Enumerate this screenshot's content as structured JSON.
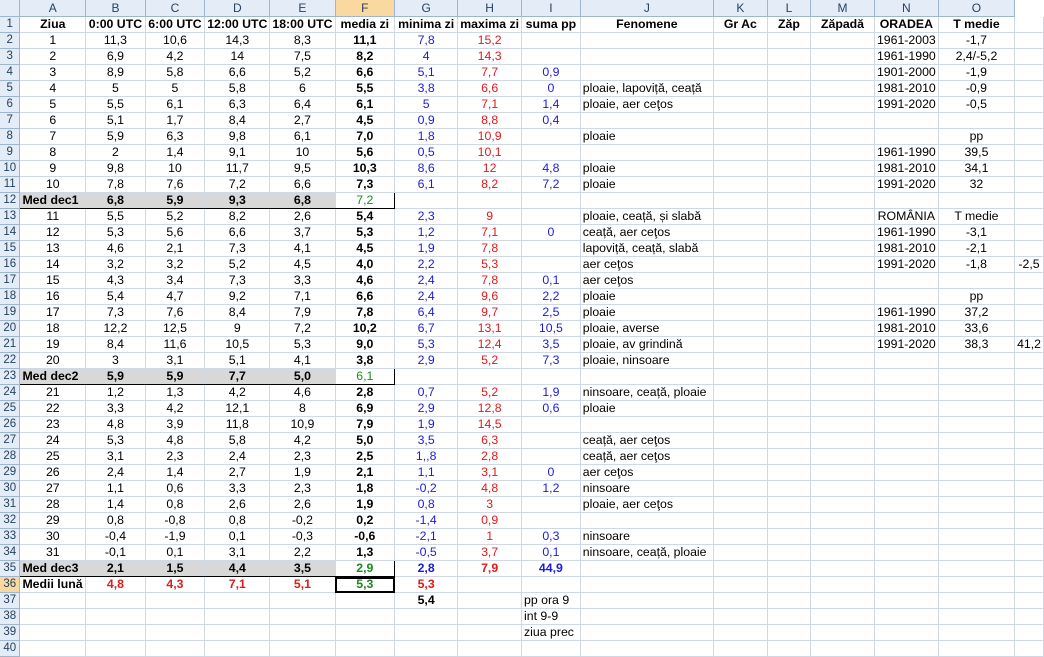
{
  "columns": [
    "A",
    "B",
    "C",
    "D",
    "E",
    "F",
    "G",
    "H",
    "I",
    "J",
    "K",
    "L",
    "M",
    "N",
    "O"
  ],
  "active_col": "F",
  "active_row": 36,
  "rows": [
    {
      "r": 1,
      "type": "header",
      "cells": [
        "Ziua",
        "0:00 UTC",
        "6:00 UTC",
        "12:00 UTC",
        "18:00 UTC",
        "media zi",
        "minima zi",
        "maxima zi",
        "suma pp",
        "Fenomene",
        "Gr Ac",
        "Zăp",
        "Zăpadă",
        "ORADEA",
        "T medie",
        ""
      ]
    },
    {
      "r": 2,
      "type": "day",
      "cells": [
        "1",
        "11,3",
        "10,6",
        "14,3",
        "8,3",
        "11,1",
        "7,8",
        "15,2",
        "",
        "",
        "",
        "",
        "",
        "1961-2003",
        "-1,7",
        ""
      ]
    },
    {
      "r": 3,
      "type": "day",
      "cells": [
        "2",
        "6,9",
        "4,2",
        "14",
        "7,5",
        "8,2",
        "4",
        "14,3",
        "",
        "",
        "",
        "",
        "",
        "1961-1990",
        "2,4/-5,2",
        ""
      ]
    },
    {
      "r": 4,
      "type": "day",
      "cells": [
        "3",
        "8,9",
        "5,8",
        "6,6",
        "5,2",
        "6,6",
        "5,1",
        "7,7",
        "0,9",
        "",
        "",
        "",
        "",
        "1901-2000",
        "-1,9",
        ""
      ]
    },
    {
      "r": 5,
      "type": "day",
      "cells": [
        "4",
        "5",
        "5",
        "5,8",
        "6",
        "5,5",
        "3,8",
        "6,6",
        "0",
        "ploaie, lapoviță, ceață",
        "",
        "",
        "",
        "1981-2010",
        "-0,9",
        ""
      ]
    },
    {
      "r": 6,
      "type": "day",
      "cells": [
        "5",
        "5,5",
        "6,1",
        "6,3",
        "6,4",
        "6,1",
        "5",
        "7,1",
        "1,4",
        "ploaie, aer ceţos",
        "",
        "",
        "",
        "1991-2020",
        "-0,5",
        ""
      ]
    },
    {
      "r": 7,
      "type": "day",
      "cells": [
        "6",
        "5,1",
        "1,7",
        "8,4",
        "2,7",
        "4,5",
        "0,9",
        "8,8",
        "0,4",
        "",
        "",
        "",
        "",
        "",
        "",
        ""
      ]
    },
    {
      "r": 8,
      "type": "day",
      "cells": [
        "7",
        "5,9",
        "6,3",
        "9,8",
        "6,1",
        "7,0",
        "1,8",
        "10,9",
        "",
        "ploaie",
        "",
        "",
        "",
        "",
        "pp",
        ""
      ]
    },
    {
      "r": 9,
      "type": "day",
      "cells": [
        "8",
        "2",
        "1,4",
        "9,1",
        "10",
        "5,6",
        "0,5",
        "10,1",
        "",
        "",
        "",
        "",
        "",
        "1961-1990",
        "39,5",
        ""
      ]
    },
    {
      "r": 10,
      "type": "day",
      "cells": [
        "9",
        "9,8",
        "10",
        "11,7",
        "9,5",
        "10,3",
        "8,6",
        "12",
        "4,8",
        "ploaie",
        "",
        "",
        "",
        "1981-2010",
        "34,1",
        ""
      ]
    },
    {
      "r": 11,
      "type": "day",
      "cells": [
        "10",
        "7,8",
        "7,6",
        "7,2",
        "6,6",
        "7,3",
        "6,1",
        "8,2",
        "7,2",
        "ploaie",
        "",
        "",
        "",
        "1991-2020",
        "32",
        ""
      ]
    },
    {
      "r": 12,
      "type": "dec",
      "cells": [
        "Med dec1",
        "6,8",
        "5,9",
        "9,3",
        "6,8",
        "7,2",
        "",
        "",
        "",
        "",
        "",
        "",
        "",
        "",
        "",
        ""
      ]
    },
    {
      "r": 13,
      "type": "day",
      "cells": [
        "11",
        "5,5",
        "5,2",
        "8,2",
        "2,6",
        "5,4",
        "2,3",
        "9",
        "",
        "ploaie, ceață, și slabă",
        "",
        "",
        "",
        "ROMÂNIA",
        "T medie",
        ""
      ]
    },
    {
      "r": 14,
      "type": "day",
      "cells": [
        "12",
        "5,3",
        "5,6",
        "6,6",
        "3,7",
        "5,3",
        "1,2",
        "7,1",
        "0",
        "ceață, aer ceţos",
        "",
        "",
        "",
        "1961-1990",
        "-3,1",
        ""
      ]
    },
    {
      "r": 15,
      "type": "day",
      "cells": [
        "13",
        "4,6",
        "2,1",
        "7,3",
        "4,1",
        "4,5",
        "1,9",
        "7,8",
        "",
        "lapoviță, ceață, slabă",
        "",
        "",
        "",
        "1981-2010",
        "-2,1",
        ""
      ]
    },
    {
      "r": 16,
      "type": "day",
      "cells": [
        "14",
        "3,2",
        "3,2",
        "5,2",
        "4,5",
        "4,0",
        "2,2",
        "5,3",
        "",
        "aer ceţos",
        "",
        "",
        "",
        "1991-2020",
        "-1,8",
        "-2,5"
      ]
    },
    {
      "r": 17,
      "type": "day",
      "cells": [
        "15",
        "4,3",
        "3,4",
        "7,3",
        "3,3",
        "4,6",
        "2,4",
        "7,8",
        "0,1",
        "aer ceţos",
        "",
        "",
        "",
        "",
        "",
        ""
      ]
    },
    {
      "r": 18,
      "type": "day",
      "cells": [
        "16",
        "5,4",
        "4,7",
        "9,2",
        "7,1",
        "6,6",
        "2,4",
        "9,6",
        "2,2",
        "ploaie",
        "",
        "",
        "",
        "",
        "pp",
        ""
      ]
    },
    {
      "r": 19,
      "type": "day",
      "cells": [
        "17",
        "7,3",
        "7,6",
        "8,4",
        "7,9",
        "7,8",
        "6,4",
        "9,7",
        "2,5",
        "ploaie",
        "",
        "",
        "",
        "1961-1990",
        "37,2",
        ""
      ]
    },
    {
      "r": 20,
      "type": "day",
      "cells": [
        "18",
        "12,2",
        "12,5",
        "9",
        "7,2",
        "10,2",
        "6,7",
        "13,1",
        "10,5",
        "ploaie, averse",
        "",
        "",
        "",
        "1981-2010",
        "33,6",
        ""
      ]
    },
    {
      "r": 21,
      "type": "day",
      "cells": [
        "19",
        "8,4",
        "11,6",
        "10,5",
        "5,3",
        "9,0",
        "5,3",
        "12,4",
        "3,5",
        "ploaie, av grindină",
        "",
        "",
        "",
        "1991-2020",
        "38,3",
        "41,2"
      ]
    },
    {
      "r": 22,
      "type": "day",
      "cells": [
        "20",
        "3",
        "3,1",
        "5,1",
        "4,1",
        "3,8",
        "2,9",
        "5,2",
        "7,3",
        "ploaie, ninsoare",
        "",
        "",
        "",
        "",
        "",
        ""
      ]
    },
    {
      "r": 23,
      "type": "dec",
      "cells": [
        "Med dec2",
        "5,9",
        "5,9",
        "7,7",
        "5,0",
        "6,1",
        "",
        "",
        "",
        "",
        "",
        "",
        "",
        "",
        "",
        ""
      ]
    },
    {
      "r": 24,
      "type": "day",
      "cells": [
        "21",
        "1,2",
        "1,3",
        "4,2",
        "4,6",
        "2,8",
        "0,7",
        "5,2",
        "1,9",
        "ninsoare, ceață, ploaie",
        "",
        "",
        "",
        "",
        "",
        ""
      ]
    },
    {
      "r": 25,
      "type": "day",
      "cells": [
        "22",
        "3,3",
        "4,2",
        "12,1",
        "8",
        "6,9",
        "2,9",
        "12,8",
        "0,6",
        "ploaie",
        "",
        "",
        "",
        "",
        "",
        ""
      ]
    },
    {
      "r": 26,
      "type": "day",
      "cells": [
        "23",
        "4,8",
        "3,9",
        "11,8",
        "10,9",
        "7,9",
        "1,9",
        "14,5",
        "",
        "",
        "",
        "",
        "",
        "",
        "",
        ""
      ]
    },
    {
      "r": 27,
      "type": "day",
      "cells": [
        "24",
        "5,3",
        "4,8",
        "5,8",
        "4,2",
        "5,0",
        "3,5",
        "6,3",
        "",
        "ceață, aer ceţos",
        "",
        "",
        "",
        "",
        "",
        ""
      ]
    },
    {
      "r": 28,
      "type": "day",
      "cells": [
        "25",
        "3,1",
        "2,3",
        "2,4",
        "2,3",
        "2,5",
        "1,,8",
        "2,8",
        "",
        "ceață, aer ceţos",
        "",
        "",
        "",
        "",
        "",
        ""
      ]
    },
    {
      "r": 29,
      "type": "day",
      "cells": [
        "26",
        "2,4",
        "1,4",
        "2,7",
        "1,9",
        "2,1",
        "1,1",
        "3,1",
        "0",
        "aer ceţos",
        "",
        "",
        "",
        "",
        "",
        ""
      ]
    },
    {
      "r": 30,
      "type": "day",
      "cells": [
        "27",
        "1,1",
        "0,6",
        "3,3",
        "2,3",
        "1,8",
        "-0,2",
        "4,8",
        "1,2",
        "ninsoare",
        "",
        "",
        "",
        "",
        "",
        ""
      ]
    },
    {
      "r": 31,
      "type": "day",
      "cells": [
        "28",
        "1,4",
        "0,8",
        "2,6",
        "2,6",
        "1,9",
        "0,8",
        "3",
        "",
        "ploaie, aer ceţos",
        "",
        "",
        "",
        "",
        "",
        ""
      ]
    },
    {
      "r": 32,
      "type": "day",
      "cells": [
        "29",
        "0,8",
        "-0,8",
        "0,8",
        "-0,2",
        "0,2",
        "-1,4",
        "0,9",
        "",
        "",
        "",
        "",
        "",
        "",
        "",
        ""
      ]
    },
    {
      "r": 33,
      "type": "day",
      "cells": [
        "30",
        "-0,4",
        "-1,9",
        "0,1",
        "-0,3",
        "-0,6",
        "-2,1",
        "1",
        "0,3",
        "ninsoare",
        "",
        "",
        "",
        "",
        "",
        ""
      ]
    },
    {
      "r": 34,
      "type": "day",
      "cells": [
        "31",
        "-0,1",
        "0,1",
        "3,1",
        "2,2",
        "1,3",
        "-0,5",
        "3,7",
        "0,1",
        "ninsoare, ceață, ploaie",
        "",
        "",
        "",
        "",
        "",
        ""
      ]
    },
    {
      "r": 35,
      "type": "dec3",
      "cells": [
        "Med dec3",
        "2,1",
        "1,5",
        "4,4",
        "3,5",
        "2,9",
        "2,8",
        "7,9",
        "44,9",
        "",
        "",
        "",
        "",
        "",
        "",
        ""
      ]
    },
    {
      "r": 36,
      "type": "month",
      "cells": [
        "Medii lună",
        "4,8",
        "4,3",
        "7,1",
        "5,1",
        "5,3",
        "5,3",
        "",
        "",
        "",
        "",
        "",
        "",
        "",
        "",
        ""
      ]
    },
    {
      "r": 37,
      "type": "plain",
      "cells": [
        "",
        "",
        "",
        "",
        "",
        "",
        "5,4",
        "",
        "pp ora 9",
        "",
        "",
        "",
        "",
        "",
        "",
        ""
      ]
    },
    {
      "r": 38,
      "type": "plain",
      "cells": [
        "",
        "",
        "",
        "",
        "",
        "",
        "",
        "",
        "int 9-9",
        "",
        "",
        "",
        "",
        "",
        "",
        ""
      ]
    },
    {
      "r": 39,
      "type": "plain",
      "cells": [
        "",
        "",
        "",
        "",
        "",
        "",
        "",
        "",
        "ziua prec",
        "",
        "",
        "",
        "",
        "",
        "",
        ""
      ]
    },
    {
      "r": 40,
      "type": "plain",
      "cells": [
        "",
        "",
        "",
        "",
        "",
        "",
        "",
        "",
        "",
        "",
        "",
        "",
        "",
        "",
        "",
        ""
      ]
    }
  ]
}
